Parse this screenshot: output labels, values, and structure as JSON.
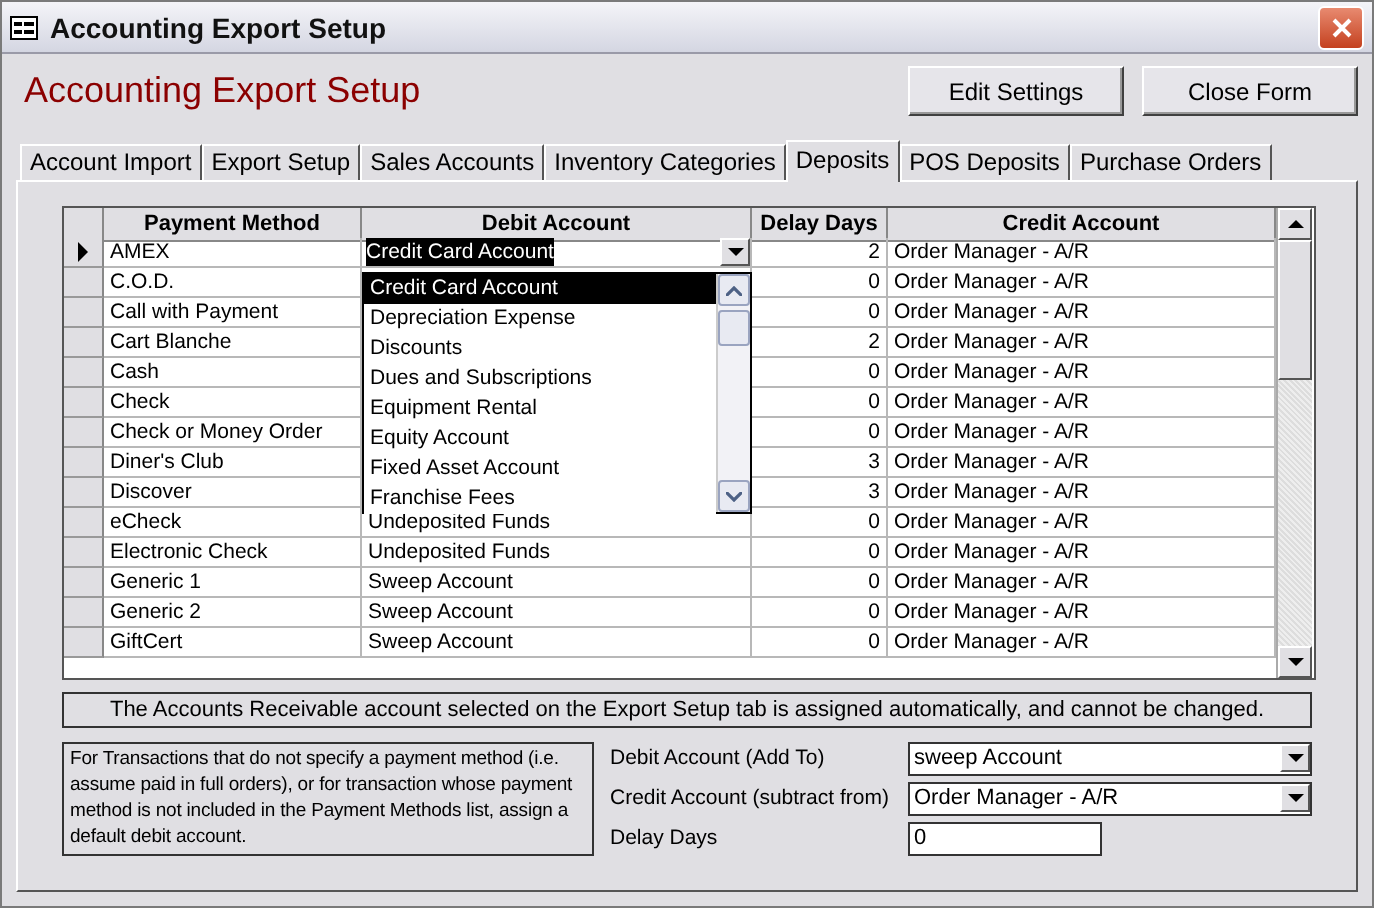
{
  "window": {
    "title": "Accounting Export Setup"
  },
  "header": {
    "title": "Accounting Export Setup",
    "buttons": [
      "Edit Settings",
      "Close Form"
    ]
  },
  "tabs": [
    {
      "label": "Account Import",
      "selected": false
    },
    {
      "label": "Export Setup",
      "selected": false
    },
    {
      "label": "Sales Accounts",
      "selected": false
    },
    {
      "label": "Inventory Categories",
      "selected": false
    },
    {
      "label": "Deposits",
      "selected": true
    },
    {
      "label": "POS Deposits",
      "selected": false
    },
    {
      "label": "Purchase Orders",
      "selected": false
    }
  ],
  "table": {
    "columns": [
      "Payment Method",
      "Debit Account",
      "Delay Days",
      "Credit Account"
    ],
    "rows": [
      {
        "current": true,
        "payment_method": "AMEX",
        "debit_account": "Credit Card Account",
        "delay_days": "2",
        "credit_account": "Order Manager - A/R"
      },
      {
        "current": false,
        "payment_method": "C.O.D.",
        "delay_days": "0",
        "credit_account": "Order Manager - A/R"
      },
      {
        "current": false,
        "payment_method": "Call with Payment",
        "delay_days": "0",
        "credit_account": "Order Manager - A/R"
      },
      {
        "current": false,
        "payment_method": "Cart Blanche",
        "delay_days": "2",
        "credit_account": "Order Manager - A/R"
      },
      {
        "current": false,
        "payment_method": "Cash",
        "delay_days": "0",
        "credit_account": "Order Manager - A/R"
      },
      {
        "current": false,
        "payment_method": "Check",
        "delay_days": "0",
        "credit_account": "Order Manager - A/R"
      },
      {
        "current": false,
        "payment_method": "Check or Money Order",
        "delay_days": "0",
        "credit_account": "Order Manager - A/R"
      },
      {
        "current": false,
        "payment_method": "Diner's Club",
        "delay_days": "3",
        "credit_account": "Order Manager - A/R"
      },
      {
        "current": false,
        "payment_method": "Discover",
        "delay_days": "3",
        "credit_account": "Order Manager - A/R"
      },
      {
        "current": false,
        "payment_method": "eCheck",
        "debit_account": "Undeposited Funds",
        "delay_days": "0",
        "credit_account": "Order Manager - A/R"
      },
      {
        "current": false,
        "payment_method": "Electronic Check",
        "debit_account": "Undeposited Funds",
        "delay_days": "0",
        "credit_account": "Order Manager - A/R"
      },
      {
        "current": false,
        "payment_method": "Generic 1",
        "debit_account": "Sweep Account",
        "delay_days": "0",
        "credit_account": "Order Manager - A/R"
      },
      {
        "current": false,
        "payment_method": "Generic 2",
        "debit_account": "Sweep Account",
        "delay_days": "0",
        "credit_account": "Order Manager - A/R"
      },
      {
        "current": false,
        "payment_method": "GiftCert",
        "debit_account": "Sweep Account",
        "delay_days": "0",
        "credit_account": "Order Manager - A/R"
      }
    ],
    "dropdown": {
      "items": [
        {
          "label": "Credit Card Account",
          "selected": true
        },
        {
          "label": "Depreciation Expense",
          "selected": false
        },
        {
          "label": "Discounts",
          "selected": false
        },
        {
          "label": "Dues and Subscriptions",
          "selected": false
        },
        {
          "label": "Equipment Rental",
          "selected": false
        },
        {
          "label": "Equity Account",
          "selected": false
        },
        {
          "label": "Fixed Asset Account",
          "selected": false
        },
        {
          "label": "Franchise Fees",
          "selected": false
        }
      ]
    }
  },
  "info_bar": "The Accounts Receivable account selected on the Export Setup tab is assigned automatically, and cannot be changed.",
  "defaults": {
    "note": "For Transactions that do not specify a payment method (i.e. assume paid in full orders), or for transaction whose payment method is not included in the Payment Methods list, assign a default debit account.",
    "fields": [
      {
        "kind": "combo",
        "label": "Debit Account (Add To)",
        "value": "sweep Account"
      },
      {
        "kind": "combo",
        "label": "Credit Account (subtract from)",
        "value": "Order Manager - A/R"
      },
      {
        "kind": "text",
        "label": "Delay Days",
        "value": "0"
      }
    ]
  }
}
